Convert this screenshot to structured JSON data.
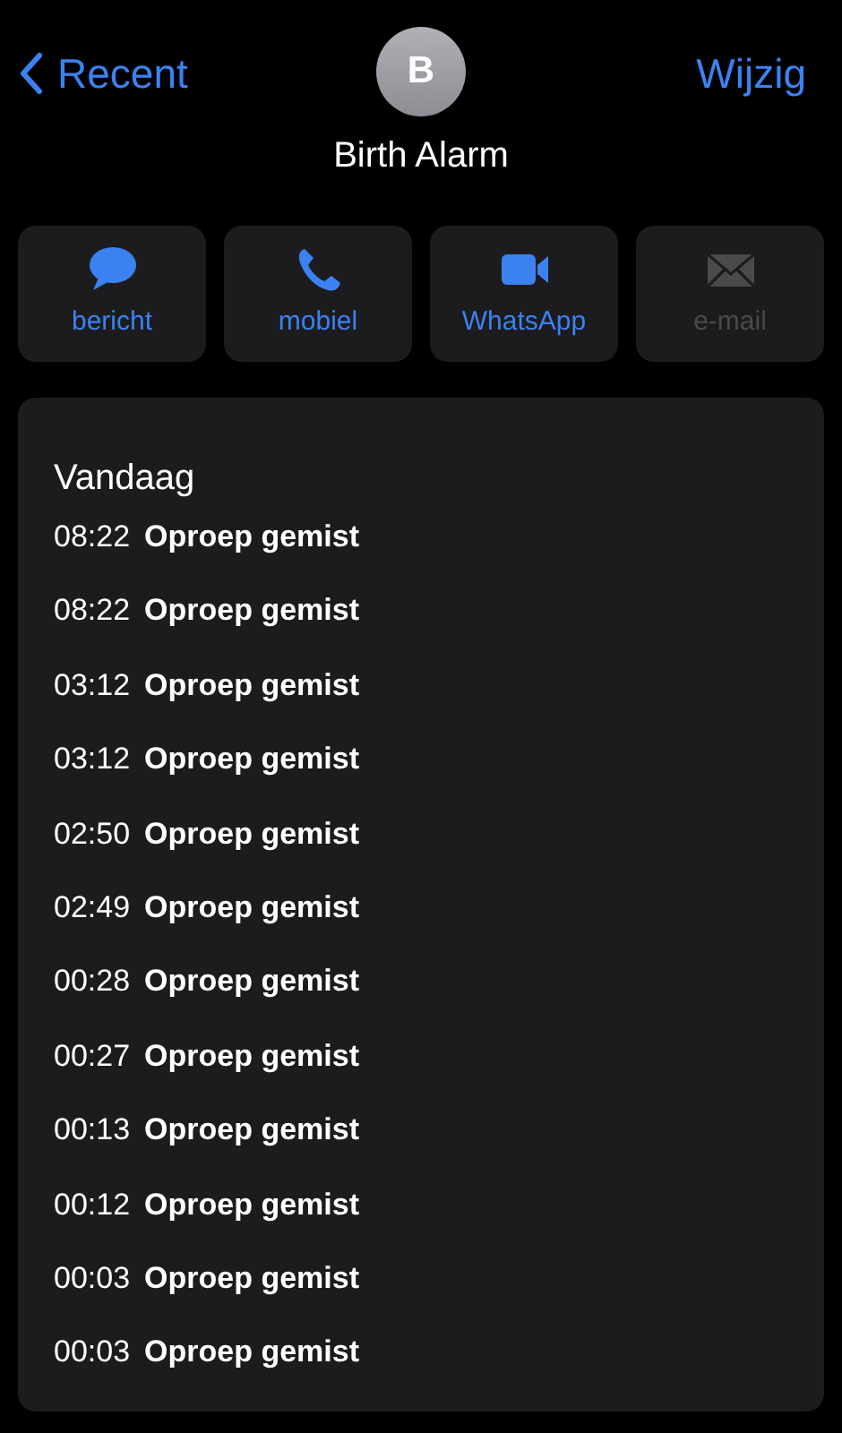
{
  "nav": {
    "back": "Recent",
    "edit": "Wijzig"
  },
  "contact": {
    "initial": "B",
    "name": "Birth Alarm"
  },
  "actions": [
    {
      "kind": "message",
      "label": "bericht",
      "disabled": false
    },
    {
      "kind": "phone",
      "label": "mobiel",
      "disabled": false
    },
    {
      "kind": "video",
      "label": "WhatsApp",
      "disabled": false
    },
    {
      "kind": "mail",
      "label": "e-mail",
      "disabled": true
    }
  ],
  "calls": {
    "heading": "Vandaag",
    "rows": [
      {
        "time": "08:22",
        "status": "Oproep gemist"
      },
      {
        "time": "08:22",
        "status": "Oproep gemist"
      },
      {
        "time": "03:12",
        "status": "Oproep gemist"
      },
      {
        "time": "03:12",
        "status": "Oproep gemist"
      },
      {
        "time": "02:50",
        "status": "Oproep gemist"
      },
      {
        "time": "02:49",
        "status": "Oproep gemist"
      },
      {
        "time": "00:28",
        "status": "Oproep gemist"
      },
      {
        "time": "00:27",
        "status": "Oproep gemist"
      },
      {
        "time": "00:13",
        "status": "Oproep gemist"
      },
      {
        "time": "00:12",
        "status": "Oproep gemist"
      },
      {
        "time": "00:03",
        "status": "Oproep gemist"
      },
      {
        "time": "00:03",
        "status": "Oproep gemist"
      }
    ]
  }
}
